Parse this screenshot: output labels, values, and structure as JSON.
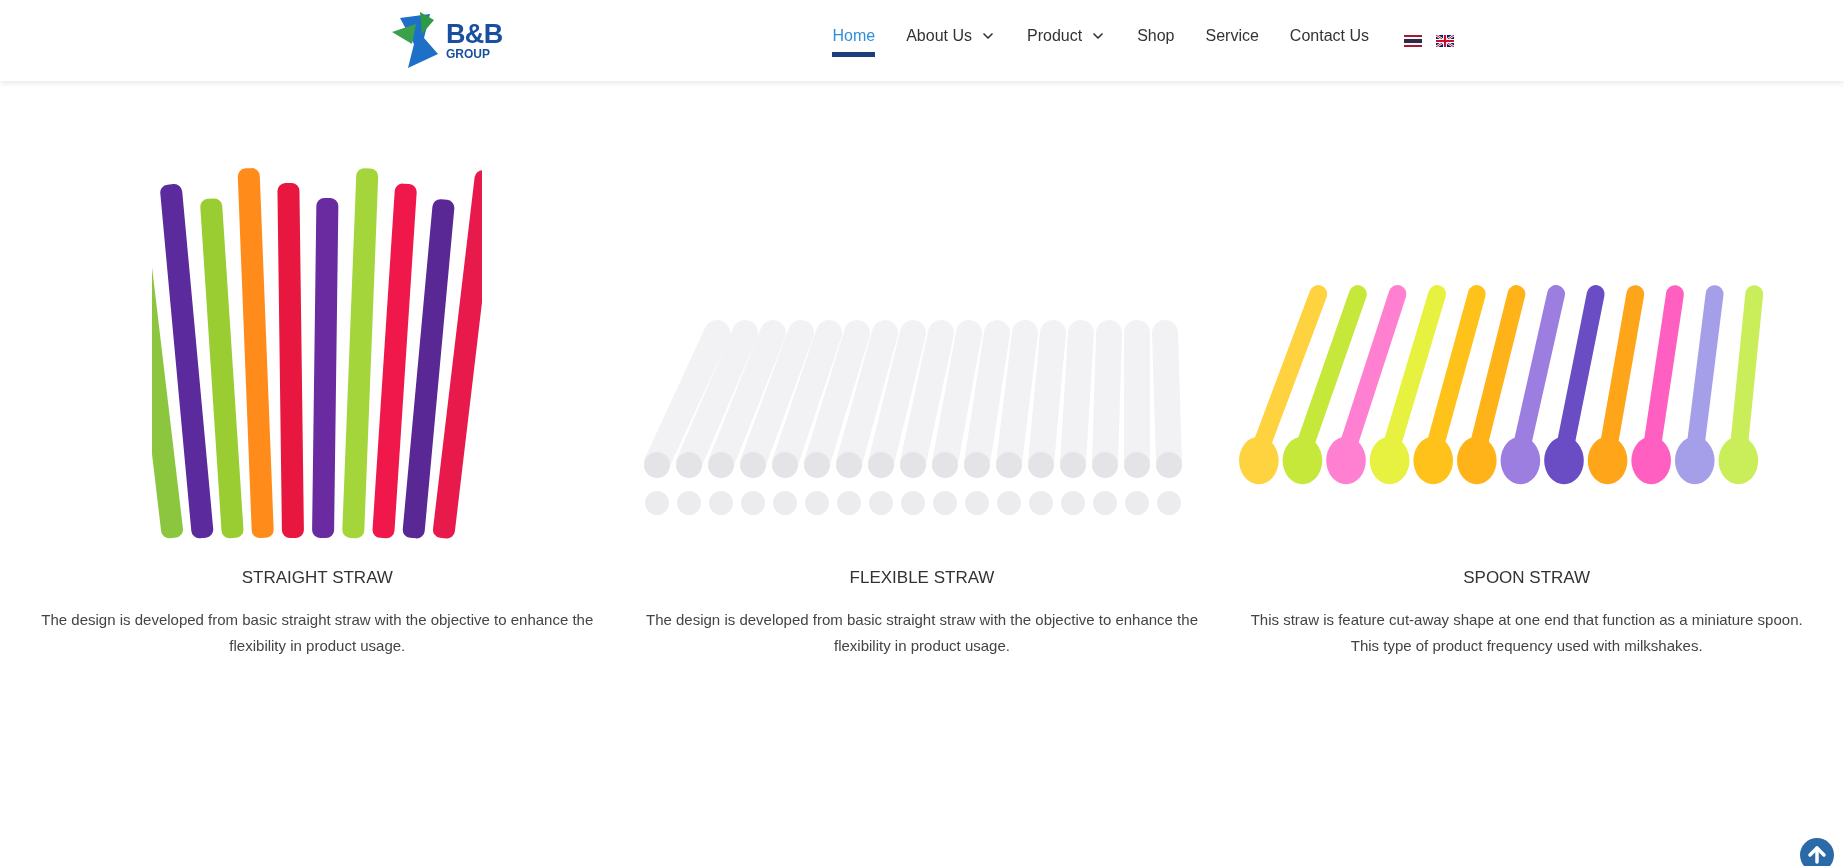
{
  "logo": {
    "title": "B&B",
    "subtitle": "GROUP"
  },
  "nav": [
    {
      "label": "Home",
      "selected": true,
      "dropdown": false
    },
    {
      "label": "About Us",
      "selected": false,
      "dropdown": true
    },
    {
      "label": "Product",
      "selected": false,
      "dropdown": true
    },
    {
      "label": "Shop",
      "selected": false,
      "dropdown": false
    },
    {
      "label": "Service",
      "selected": false,
      "dropdown": false
    },
    {
      "label": "Contact Us",
      "selected": false,
      "dropdown": false
    }
  ],
  "languages": [
    {
      "kind": "thai"
    },
    {
      "kind": "uk"
    }
  ],
  "products": [
    {
      "kind": "straight",
      "title": "STRAIGHT STRAW",
      "description": "The design is developed from basic straight straw with the objective to enhance the flexibility in product usage."
    },
    {
      "kind": "flexible",
      "title": "FLEXIBLE STRAW",
      "description": "The design is developed from basic straight straw with the objective to enhance the flexibility in product usage."
    },
    {
      "kind": "spoon",
      "title": "SPOON STRAW",
      "description": "This straw is feature cut-away shape at one end that function as a miniature spoon. This type of product frequency used with milkshakes."
    }
  ]
}
